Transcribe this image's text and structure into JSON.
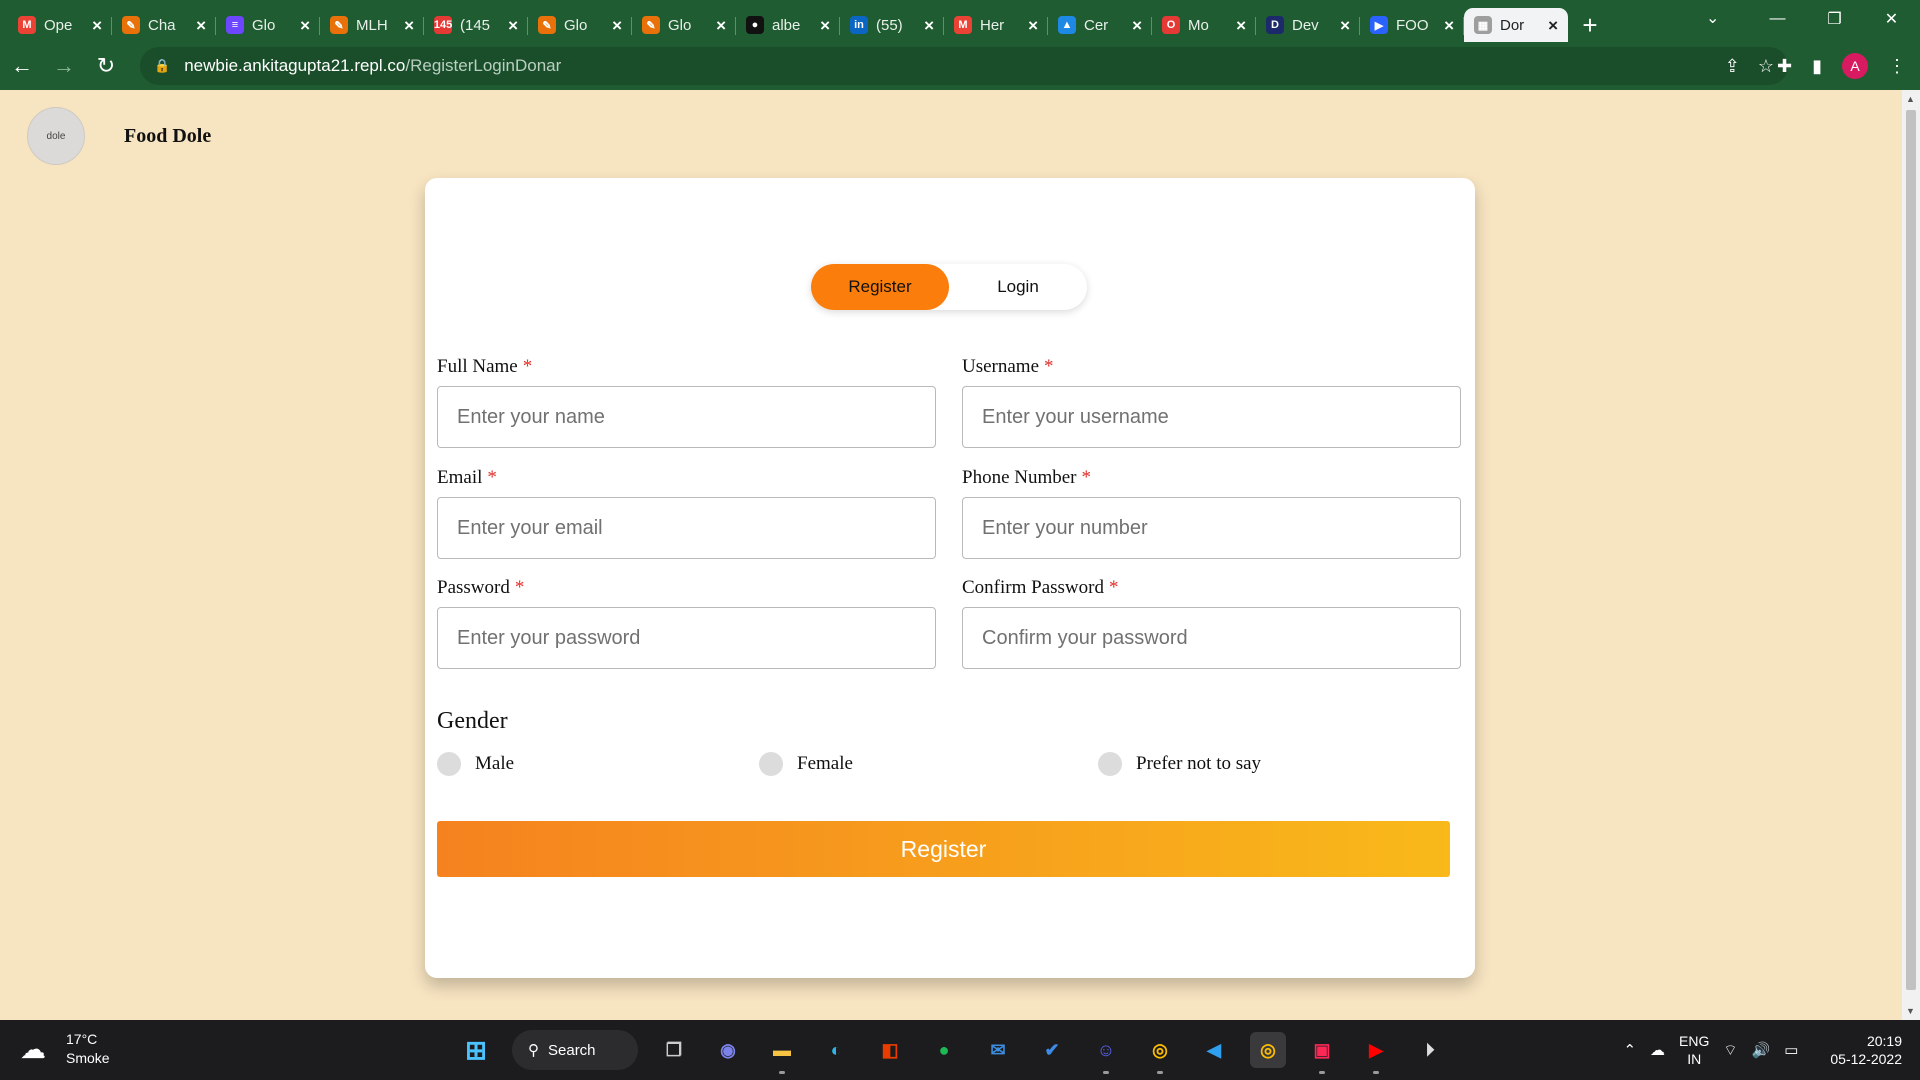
{
  "browser": {
    "tabs": [
      {
        "title": "Ope",
        "icon": "M",
        "color": "#ea4335"
      },
      {
        "title": "Cha",
        "icon": "✎",
        "color": "#e8710a"
      },
      {
        "title": "Glo",
        "icon": "≡",
        "color": "#6c47ff"
      },
      {
        "title": "MLH",
        "icon": "✎",
        "color": "#e8710a"
      },
      {
        "title": "(145",
        "icon": "145",
        "color": "#e53935"
      },
      {
        "title": "Glo",
        "icon": "✎",
        "color": "#e8710a"
      },
      {
        "title": "Glo",
        "icon": "✎",
        "color": "#e8710a"
      },
      {
        "title": "albe",
        "icon": "●",
        "color": "#111111"
      },
      {
        "title": "(55)",
        "icon": "in",
        "color": "#0a66c2"
      },
      {
        "title": "Her",
        "icon": "M",
        "color": "#ea4335"
      },
      {
        "title": "Cer",
        "icon": "▲",
        "color": "#1e88e5"
      },
      {
        "title": "Mo",
        "icon": "O",
        "color": "#e53935"
      },
      {
        "title": "Dev",
        "icon": "D",
        "color": "#1c2a6b"
      },
      {
        "title": "FOO",
        "icon": "▶",
        "color": "#2962ff"
      },
      {
        "title": "Dor",
        "icon": "▦",
        "color": "#9e9e9e",
        "active": true
      }
    ],
    "new_tab": "+",
    "url_host": "newbie.ankitagupta21.repl.co",
    "url_path": "/RegisterLoginDonar",
    "profile_initial": "A"
  },
  "site": {
    "logo_text": "dole",
    "brand": "Food Dole"
  },
  "form": {
    "toggle": {
      "register": "Register",
      "login": "Login"
    },
    "required_mark": "*",
    "fields": {
      "full_name": {
        "label": "Full Name",
        "placeholder": "Enter your name"
      },
      "username": {
        "label": "Username",
        "placeholder": "Enter your username"
      },
      "email": {
        "label": "Email",
        "placeholder": "Enter your email"
      },
      "phone": {
        "label": "Phone Number",
        "placeholder": "Enter your number"
      },
      "password": {
        "label": "Password",
        "placeholder": "Enter your password"
      },
      "confirm": {
        "label": "Confirm Password",
        "placeholder": "Confirm your password"
      }
    },
    "gender": {
      "title": "Gender",
      "options": [
        "Male",
        "Female",
        "Prefer not to say"
      ]
    },
    "submit": "Register"
  },
  "taskbar": {
    "weather_temp": "17°C",
    "weather_desc": "Smoke",
    "search": "Search",
    "lang_top": "ENG",
    "lang_bottom": "IN",
    "time": "20:19",
    "date": "05-12-2022"
  },
  "colors": {
    "accent": "#fb7d0b",
    "page_bg": "#f7e4c1",
    "chrome": "#1f5c32",
    "required": "#e0302b"
  }
}
